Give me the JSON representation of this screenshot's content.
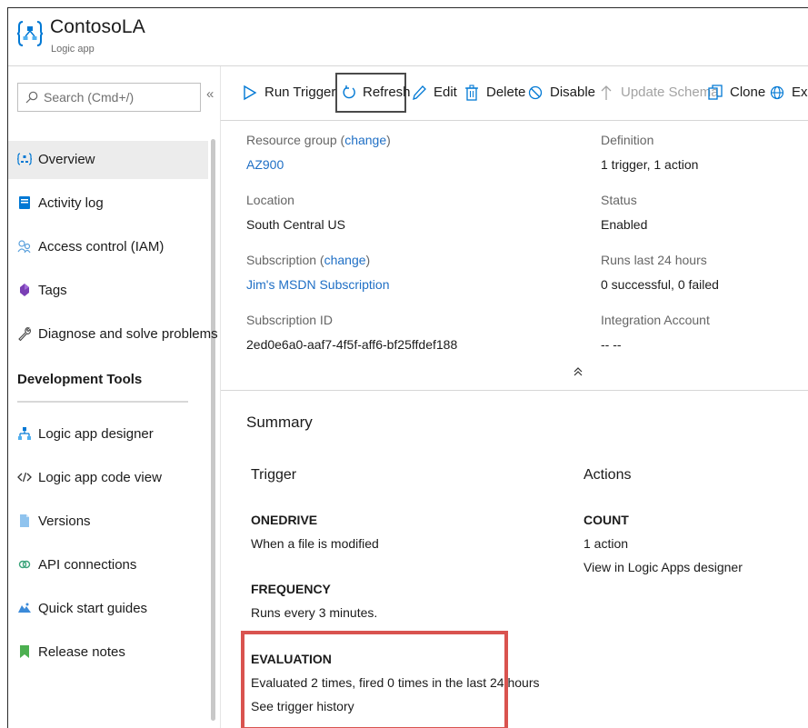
{
  "app": {
    "title": "ContosoLA",
    "subtitle": "Logic app",
    "icon": "logic-app-icon"
  },
  "sidebar": {
    "search_placeholder": "Search (Cmd+/)",
    "collapse_glyph": "«",
    "items": [
      {
        "label": "Overview",
        "icon": "overview-icon",
        "active": true
      },
      {
        "label": "Activity log",
        "icon": "activity-log-icon"
      },
      {
        "label": "Access control (IAM)",
        "icon": "iam-icon"
      },
      {
        "label": "Tags",
        "icon": "tag-icon"
      },
      {
        "label": "Diagnose and solve problems",
        "icon": "wrench-icon"
      }
    ],
    "section_title": "Development Tools",
    "dev_items": [
      {
        "label": "Logic app designer",
        "icon": "designer-icon"
      },
      {
        "label": "Logic app code view",
        "icon": "code-icon"
      },
      {
        "label": "Versions",
        "icon": "versions-icon"
      },
      {
        "label": "API connections",
        "icon": "api-connections-icon"
      },
      {
        "label": "Quick start guides",
        "icon": "quick-start-icon"
      },
      {
        "label": "Release notes",
        "icon": "release-notes-icon"
      }
    ]
  },
  "toolbar": {
    "run_trigger": "Run Trigger",
    "refresh": "Refresh",
    "edit": "Edit",
    "delete": "Delete",
    "disable": "Disable",
    "update_schema": "Update Schema",
    "clone": "Clone",
    "export": "Export"
  },
  "essentials": {
    "resource_group_label": "Resource group",
    "change_link": "change",
    "resource_group_value": "AZ900",
    "location_label": "Location",
    "location_value": "South Central US",
    "subscription_label": "Subscription",
    "subscription_value": "Jim's MSDN Subscription",
    "subscription_id_label": "Subscription ID",
    "subscription_id_value": "2ed0e6a0-aaf7-4f5f-aff6-bf25ffdef188",
    "definition_label": "Definition",
    "definition_value": "1 trigger, 1 action",
    "status_label": "Status",
    "status_value": "Enabled",
    "runs_label": "Runs last 24 hours",
    "runs_value": "0 successful, 0 failed",
    "integration_label": "Integration Account",
    "integration_value": "-- --",
    "collapse_glyph": "⌃"
  },
  "summary": {
    "title": "Summary",
    "trigger_head": "Trigger",
    "actions_head": "Actions",
    "onedrive_cap": "ONEDRIVE",
    "onedrive_text": "When a file is modified",
    "frequency_cap": "FREQUENCY",
    "frequency_text": "Runs every 3 minutes.",
    "evaluation_cap": "EVALUATION",
    "evaluation_text": "Evaluated 2 times, fired 0 times in the last 24 hours",
    "trigger_history_link": "See trigger history",
    "count_cap": "COUNT",
    "count_text": "1 action",
    "designer_link": "View in Logic Apps designer"
  },
  "colors": {
    "link": "#1f6fc5",
    "highlight": "#d9534f",
    "azure_blue": "#0078d4"
  }
}
